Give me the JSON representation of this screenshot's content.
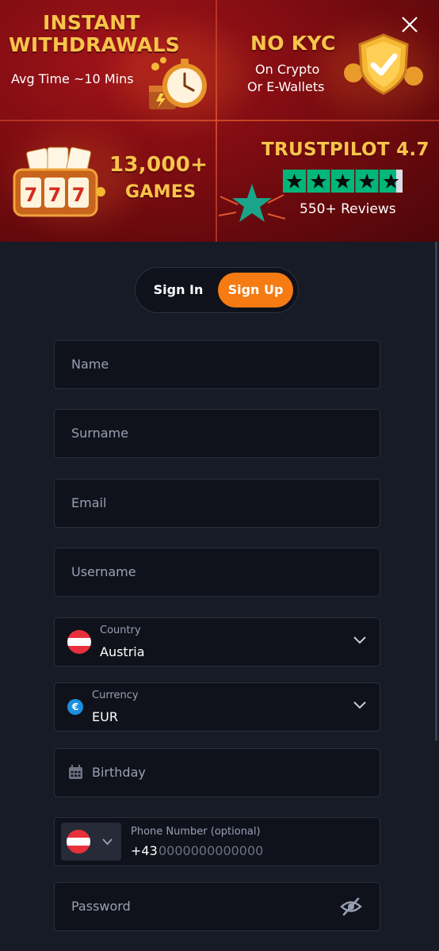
{
  "banner": {
    "withdrawals": {
      "title_line1": "INSTANT",
      "title_line2": "WITHDRAWALS",
      "subtitle": "Avg Time ~10 Mins"
    },
    "kyc": {
      "title": "NO KYC",
      "subtitle_line1": "On Crypto",
      "subtitle_line2": "Or E-Wallets"
    },
    "games": {
      "count": "13,000+",
      "label": "GAMES"
    },
    "trustpilot": {
      "title": "TRUSTPILOT 4.7",
      "rating": 4.7,
      "reviews": "550+ Reviews"
    },
    "close_icon": "close-icon"
  },
  "auth_tabs": {
    "sign_in": "Sign In",
    "sign_up": "Sign Up",
    "active": "sign_up"
  },
  "form": {
    "name_placeholder": "Name",
    "surname_placeholder": "Surname",
    "email_placeholder": "Email",
    "username_placeholder": "Username",
    "country": {
      "label": "Country",
      "value": "Austria",
      "flag_icon": "austria-flag-icon"
    },
    "currency": {
      "label": "Currency",
      "value": "EUR",
      "icon": "euro-icon"
    },
    "birthday_placeholder": "Birthday",
    "phone": {
      "label": "Phone Number (optional)",
      "prefix": "+43",
      "placeholder": "0000000000000"
    },
    "password_placeholder": "Password"
  },
  "colors": {
    "accent": "#f57b12",
    "banner_gold": "#f8c44b",
    "background": "#171b26",
    "field_bg": "#0f121b",
    "trustpilot_green": "#00b67a"
  }
}
